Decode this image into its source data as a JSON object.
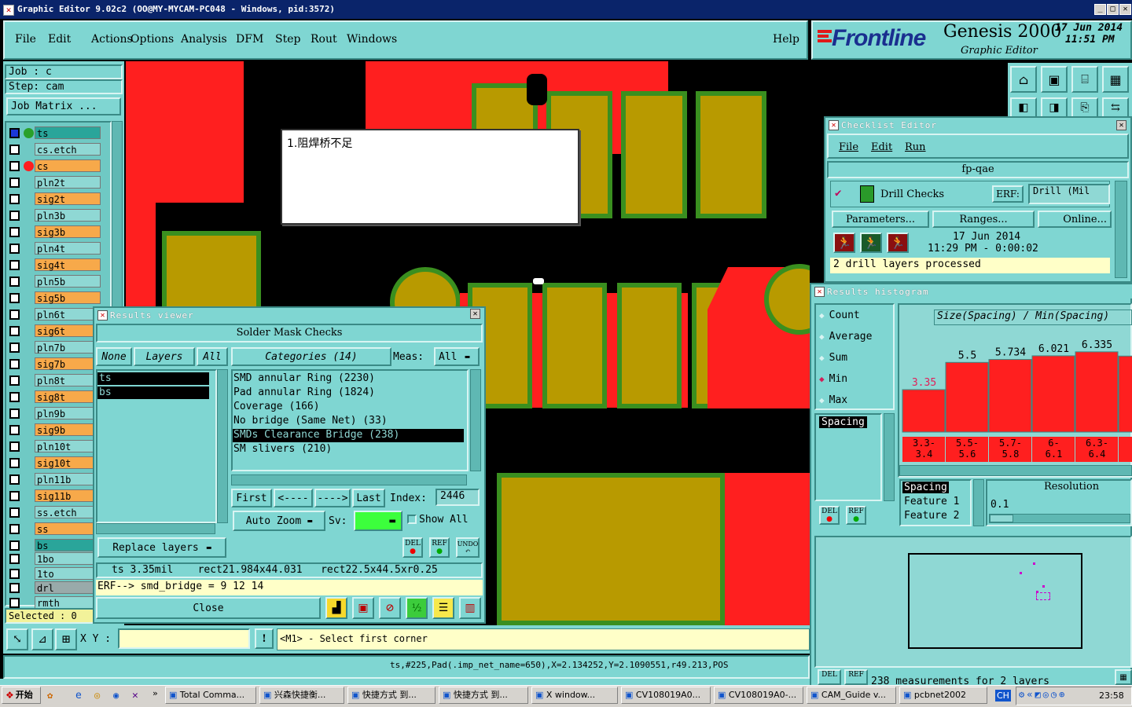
{
  "window": {
    "title": "Graphic Editor 9.02c2 (OO@MY-MYCAM-PC048 - Windows, pid:3572)"
  },
  "menu": [
    "File",
    "Edit",
    "Actions",
    "Options",
    "Analysis",
    "DFM",
    "Step",
    "Rout",
    "Windows"
  ],
  "help": "Help",
  "brand": {
    "logo": "Frontline",
    "product": "Genesis 2000",
    "subtitle": "Graphic Editor",
    "date": "17 Jun 2014",
    "time": "11:51 PM"
  },
  "job": {
    "job_label": "Job : c",
    "step_label": "Step: cam",
    "matrix_button": "Job Matrix ..."
  },
  "layers": [
    "ts",
    "cs.etch",
    "cs",
    "pln2t",
    "sig2t",
    "pln3b",
    "sig3b",
    "pln4t",
    "sig4t",
    "pln5b",
    "sig5b",
    "pln6t",
    "sig6t",
    "pln7b",
    "sig7b",
    "pln8t",
    "sig8t",
    "pln9b",
    "sig9b",
    "pln10t",
    "sig10t",
    "pln11b",
    "sig11b",
    "ss.etch",
    "ss",
    "bs",
    "1bo",
    "1to",
    "drl",
    "rmth"
  ],
  "selected": "Selected : 0",
  "note": "1.阻焊桥不足",
  "coord": {
    "label": "X Y :",
    "value": ""
  },
  "prompt": "<M1> - Select first corner",
  "status": "ts,#225,Pad(.imp_net_name=650),X=2.134252,Y=2.1090551,r49.213,POS",
  "results": {
    "title": "Results viewer",
    "header": "Solder Mask Checks",
    "none": "None",
    "layers": "Layers",
    "all": "All",
    "categories": "Categories (14)",
    "meas_label": "Meas:",
    "meas_value": "All",
    "layer_list": [
      "ts",
      "bs"
    ],
    "category_list": [
      "SMD annular Ring (2230)",
      "Pad annular Ring (1824)",
      "Coverage (166)",
      "No bridge (Same Net) (33)",
      "SMDs Clearance Bridge (238)",
      "SM slivers (210)"
    ],
    "selected_category": "SMDs Clearance Bridge (238)",
    "first": "First",
    "prev": "<----",
    "next": "---->",
    "last": "Last",
    "index_label": "Index:",
    "index_value": "2446",
    "auto_zoom": "Auto Zoom",
    "sv": "Sv:",
    "show_all": "Show All",
    "replace_layers": "Replace layers",
    "del": "DEL",
    "ref": "REF",
    "undo": "UNDO",
    "measure_line": "ts 3.35mil    rect21.984x44.031   rect22.5x44.5xr0.25",
    "erf_line": "ERF--> smd_bridge = 9 12 14",
    "close": "Close"
  },
  "checklist": {
    "title": "Checklist Editor",
    "menu": [
      "File",
      "Edit",
      "Run"
    ],
    "name": "fp-qae",
    "check_name": "Drill Checks",
    "erf_label": "ERF:",
    "erf_value": "Drill (Mil",
    "parameters": "Parameters...",
    "ranges": "Ranges...",
    "online": "Online...",
    "date": "17 Jun 2014",
    "time": "11:29 PM - 0:00:02",
    "status": "2 drill layers processed"
  },
  "histogram": {
    "title": "Results histogram",
    "modes": [
      "Count",
      "Average",
      "Sum",
      "Min",
      "Max"
    ],
    "selected_mode": "Min",
    "header": "Size(Spacing) / Min(Spacing)",
    "filter": "Spacing",
    "bar_values": [
      "3.35",
      "5.5",
      "5.734",
      "6.021",
      "6.335",
      "6"
    ],
    "bin_labels": [
      "3.3-\n3.4",
      "5.5-\n5.6",
      "5.7-\n5.8",
      "6-\n6.1",
      "6.3-\n6.4",
      "6"
    ],
    "spacing_list": [
      "Spacing",
      "Feature 1",
      "Feature 2"
    ],
    "resolution_label": "Resolution",
    "resolution_value": "0.1",
    "footer": "238 measurements for 2 layers"
  },
  "chart_data": {
    "type": "bar",
    "title": "Size(Spacing) / Min(Spacing)",
    "categories": [
      "3.3-3.4",
      "5.5-5.6",
      "5.7-5.8",
      "6-6.1",
      "6.3-6.4",
      "6"
    ],
    "values": [
      3.35,
      5.5,
      5.734,
      6.021,
      6.335,
      6
    ],
    "bar_color": "#ff1f1f"
  },
  "taskbar": {
    "start": "开始",
    "items": [
      "Total Comma...",
      "兴森快捷衡...",
      "快捷方式 到...",
      "快捷方式 到...",
      "X window...",
      "CV108019A0...",
      "CV108019A0-...",
      "CAM_Guide v...",
      "pcbnet2002"
    ],
    "ime": "CH",
    "clock": "23:58"
  },
  "colors": {
    "panel": "#7fd6d2",
    "pad": "#b89a00",
    "copper": "#ff1f1f",
    "mask": "#3a8f1f"
  }
}
